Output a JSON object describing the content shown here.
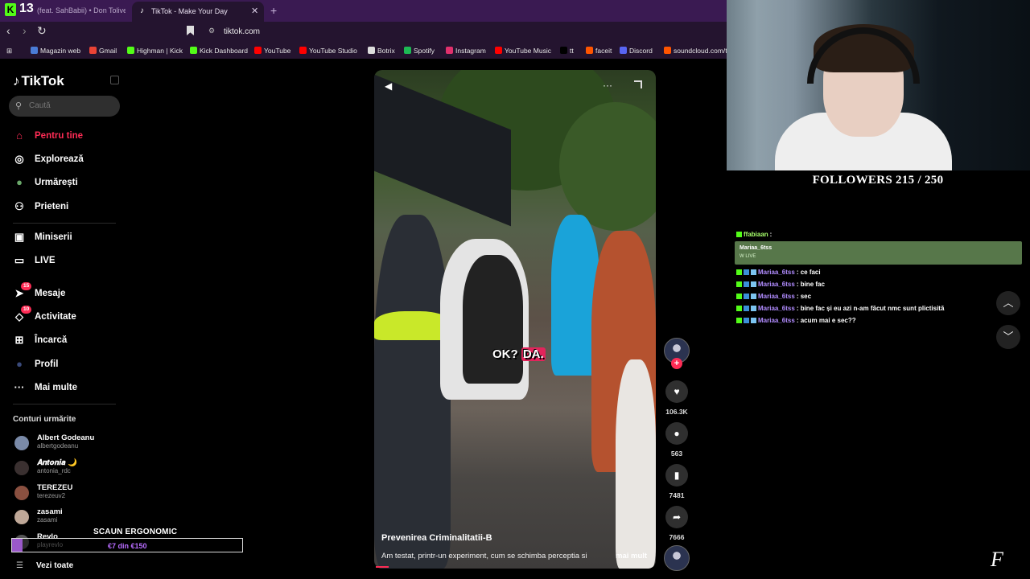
{
  "browser": {
    "tabs": [
      {
        "label": "(feat. SahBabii) • Don Toliver,"
      },
      {
        "label": "TikTok - Make Your Day"
      }
    ],
    "kick_logo": "K",
    "kick_number": "13",
    "url": "tiktok.com",
    "bookmarks": [
      {
        "label": "Magazin web",
        "color": "#4a7bd6"
      },
      {
        "label": "Gmail",
        "color": "#ea4335"
      },
      {
        "label": "Highman | Kick",
        "color": "#53fc18"
      },
      {
        "label": "Kick Dashboard",
        "color": "#53fc18"
      },
      {
        "label": "YouTube",
        "color": "#ff0000"
      },
      {
        "label": "YouTube Studio",
        "color": "#ff0000"
      },
      {
        "label": "Botrix",
        "color": "#dddddd"
      },
      {
        "label": "Spotify",
        "color": "#1db954"
      },
      {
        "label": "Instagram",
        "color": "#e1306c"
      },
      {
        "label": "YouTube Music",
        "color": "#ff0000"
      },
      {
        "label": "tt",
        "color": "#000000"
      },
      {
        "label": "faceit",
        "color": "#ff5500"
      },
      {
        "label": "Discord",
        "color": "#5865f2"
      },
      {
        "label": "soundcloud.com/t",
        "color": "#ff5500"
      }
    ]
  },
  "tiktok": {
    "logo": "TikTok",
    "search_placeholder": "Caută",
    "nav": [
      {
        "label": "Pentru tine",
        "icon": "home-icon",
        "active": true
      },
      {
        "label": "Explorează",
        "icon": "compass-icon"
      },
      {
        "label": "Urmărești",
        "icon": "following-avatar-icon"
      },
      {
        "label": "Prieteni",
        "icon": "friends-icon"
      },
      {
        "label": "Miniserii",
        "icon": "miniseries-icon"
      },
      {
        "label": "LIVE",
        "icon": "live-icon"
      },
      {
        "label": "Mesaje",
        "icon": "messages-icon",
        "badge": "15"
      },
      {
        "label": "Activitate",
        "icon": "activity-icon",
        "badge": "10"
      },
      {
        "label": "Încarcă",
        "icon": "upload-icon"
      },
      {
        "label": "Profil",
        "icon": "profile-icon"
      },
      {
        "label": "Mai multe",
        "icon": "more-icon"
      }
    ],
    "following_heading": "Conturi urmărite",
    "accounts": [
      {
        "name": "Albert Godeanu",
        "handle": "albertgodeanu"
      },
      {
        "name": "𝑨𝒏𝒕𝒐𝒏𝒊𝒂 🌙",
        "handle": "antonia_rdc"
      },
      {
        "name": "TEREZEU",
        "handle": "terezeuv2"
      },
      {
        "name": "zasami",
        "handle": "zasami"
      },
      {
        "name": "Revlo",
        "handle": "playrevlo"
      }
    ],
    "see_all": "Vezi toate"
  },
  "ad": {
    "title": "SCAUN ERGONOMIC",
    "progress": "€7 din €150",
    "progress_fraction": 0.047
  },
  "video": {
    "sticker_text": "OK?",
    "sticker_highlight": "DA.",
    "title": "Prevenirea Criminalitatii-B",
    "description": "Am testat, printr-un experiment, cum se schimba perceptia si",
    "more": "mai mult",
    "likes": "106.3K",
    "comments": "563",
    "saves": "7481",
    "shares": "7666"
  },
  "stream": {
    "followers": "FOLLOWERS 215 / 250",
    "chat_highlight": {
      "name": "Mariaa_6tss",
      "sub": "W LIVE"
    },
    "chat": [
      {
        "user": "ffabiaan",
        "message": ":",
        "green": true
      },
      {
        "user": "Mariaa_6tss",
        "message": ": ce faci"
      },
      {
        "user": "Mariaa_6tss",
        "message": ": bine fac"
      },
      {
        "user": "Mariaa_6tss",
        "message": ": sec"
      },
      {
        "user": "Mariaa_6tss",
        "message": ": bine fac și eu azi n-am făcut nmc sunt plictisită"
      },
      {
        "user": "Mariaa_6tss",
        "message": ": acum mai e sec??"
      }
    ],
    "logo": "F"
  }
}
